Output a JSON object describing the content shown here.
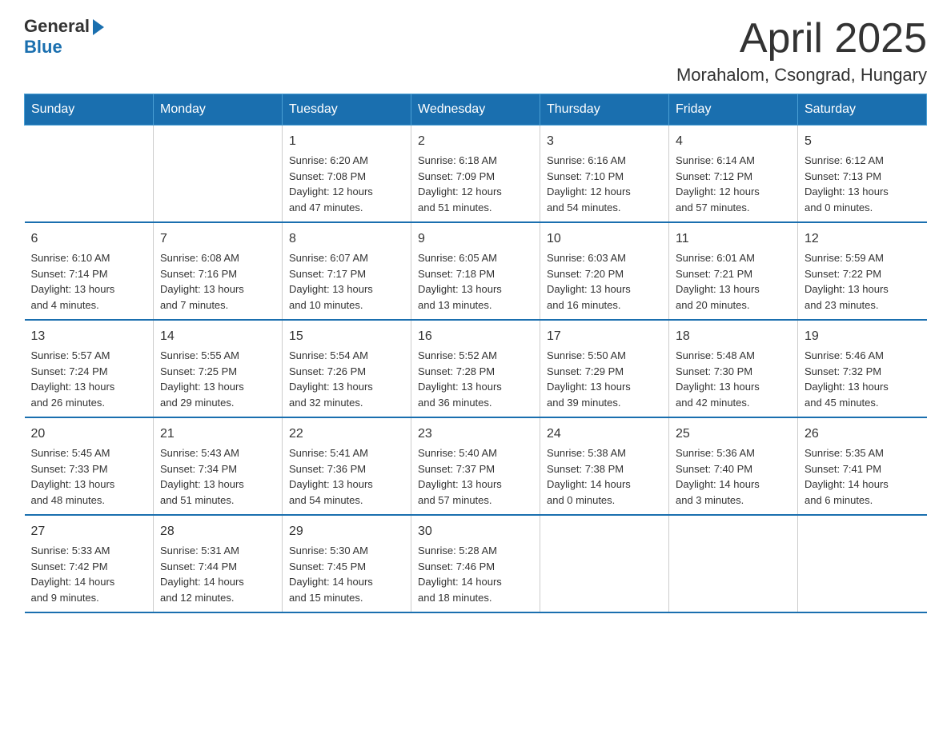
{
  "logo": {
    "text_general": "General",
    "text_blue": "Blue"
  },
  "title": {
    "month_year": "April 2025",
    "location": "Morahalom, Csongrad, Hungary"
  },
  "weekdays": [
    "Sunday",
    "Monday",
    "Tuesday",
    "Wednesday",
    "Thursday",
    "Friday",
    "Saturday"
  ],
  "weeks": [
    [
      {
        "day": "",
        "info": ""
      },
      {
        "day": "",
        "info": ""
      },
      {
        "day": "1",
        "info": "Sunrise: 6:20 AM\nSunset: 7:08 PM\nDaylight: 12 hours\nand 47 minutes."
      },
      {
        "day": "2",
        "info": "Sunrise: 6:18 AM\nSunset: 7:09 PM\nDaylight: 12 hours\nand 51 minutes."
      },
      {
        "day": "3",
        "info": "Sunrise: 6:16 AM\nSunset: 7:10 PM\nDaylight: 12 hours\nand 54 minutes."
      },
      {
        "day": "4",
        "info": "Sunrise: 6:14 AM\nSunset: 7:12 PM\nDaylight: 12 hours\nand 57 minutes."
      },
      {
        "day": "5",
        "info": "Sunrise: 6:12 AM\nSunset: 7:13 PM\nDaylight: 13 hours\nand 0 minutes."
      }
    ],
    [
      {
        "day": "6",
        "info": "Sunrise: 6:10 AM\nSunset: 7:14 PM\nDaylight: 13 hours\nand 4 minutes."
      },
      {
        "day": "7",
        "info": "Sunrise: 6:08 AM\nSunset: 7:16 PM\nDaylight: 13 hours\nand 7 minutes."
      },
      {
        "day": "8",
        "info": "Sunrise: 6:07 AM\nSunset: 7:17 PM\nDaylight: 13 hours\nand 10 minutes."
      },
      {
        "day": "9",
        "info": "Sunrise: 6:05 AM\nSunset: 7:18 PM\nDaylight: 13 hours\nand 13 minutes."
      },
      {
        "day": "10",
        "info": "Sunrise: 6:03 AM\nSunset: 7:20 PM\nDaylight: 13 hours\nand 16 minutes."
      },
      {
        "day": "11",
        "info": "Sunrise: 6:01 AM\nSunset: 7:21 PM\nDaylight: 13 hours\nand 20 minutes."
      },
      {
        "day": "12",
        "info": "Sunrise: 5:59 AM\nSunset: 7:22 PM\nDaylight: 13 hours\nand 23 minutes."
      }
    ],
    [
      {
        "day": "13",
        "info": "Sunrise: 5:57 AM\nSunset: 7:24 PM\nDaylight: 13 hours\nand 26 minutes."
      },
      {
        "day": "14",
        "info": "Sunrise: 5:55 AM\nSunset: 7:25 PM\nDaylight: 13 hours\nand 29 minutes."
      },
      {
        "day": "15",
        "info": "Sunrise: 5:54 AM\nSunset: 7:26 PM\nDaylight: 13 hours\nand 32 minutes."
      },
      {
        "day": "16",
        "info": "Sunrise: 5:52 AM\nSunset: 7:28 PM\nDaylight: 13 hours\nand 36 minutes."
      },
      {
        "day": "17",
        "info": "Sunrise: 5:50 AM\nSunset: 7:29 PM\nDaylight: 13 hours\nand 39 minutes."
      },
      {
        "day": "18",
        "info": "Sunrise: 5:48 AM\nSunset: 7:30 PM\nDaylight: 13 hours\nand 42 minutes."
      },
      {
        "day": "19",
        "info": "Sunrise: 5:46 AM\nSunset: 7:32 PM\nDaylight: 13 hours\nand 45 minutes."
      }
    ],
    [
      {
        "day": "20",
        "info": "Sunrise: 5:45 AM\nSunset: 7:33 PM\nDaylight: 13 hours\nand 48 minutes."
      },
      {
        "day": "21",
        "info": "Sunrise: 5:43 AM\nSunset: 7:34 PM\nDaylight: 13 hours\nand 51 minutes."
      },
      {
        "day": "22",
        "info": "Sunrise: 5:41 AM\nSunset: 7:36 PM\nDaylight: 13 hours\nand 54 minutes."
      },
      {
        "day": "23",
        "info": "Sunrise: 5:40 AM\nSunset: 7:37 PM\nDaylight: 13 hours\nand 57 minutes."
      },
      {
        "day": "24",
        "info": "Sunrise: 5:38 AM\nSunset: 7:38 PM\nDaylight: 14 hours\nand 0 minutes."
      },
      {
        "day": "25",
        "info": "Sunrise: 5:36 AM\nSunset: 7:40 PM\nDaylight: 14 hours\nand 3 minutes."
      },
      {
        "day": "26",
        "info": "Sunrise: 5:35 AM\nSunset: 7:41 PM\nDaylight: 14 hours\nand 6 minutes."
      }
    ],
    [
      {
        "day": "27",
        "info": "Sunrise: 5:33 AM\nSunset: 7:42 PM\nDaylight: 14 hours\nand 9 minutes."
      },
      {
        "day": "28",
        "info": "Sunrise: 5:31 AM\nSunset: 7:44 PM\nDaylight: 14 hours\nand 12 minutes."
      },
      {
        "day": "29",
        "info": "Sunrise: 5:30 AM\nSunset: 7:45 PM\nDaylight: 14 hours\nand 15 minutes."
      },
      {
        "day": "30",
        "info": "Sunrise: 5:28 AM\nSunset: 7:46 PM\nDaylight: 14 hours\nand 18 minutes."
      },
      {
        "day": "",
        "info": ""
      },
      {
        "day": "",
        "info": ""
      },
      {
        "day": "",
        "info": ""
      }
    ]
  ]
}
